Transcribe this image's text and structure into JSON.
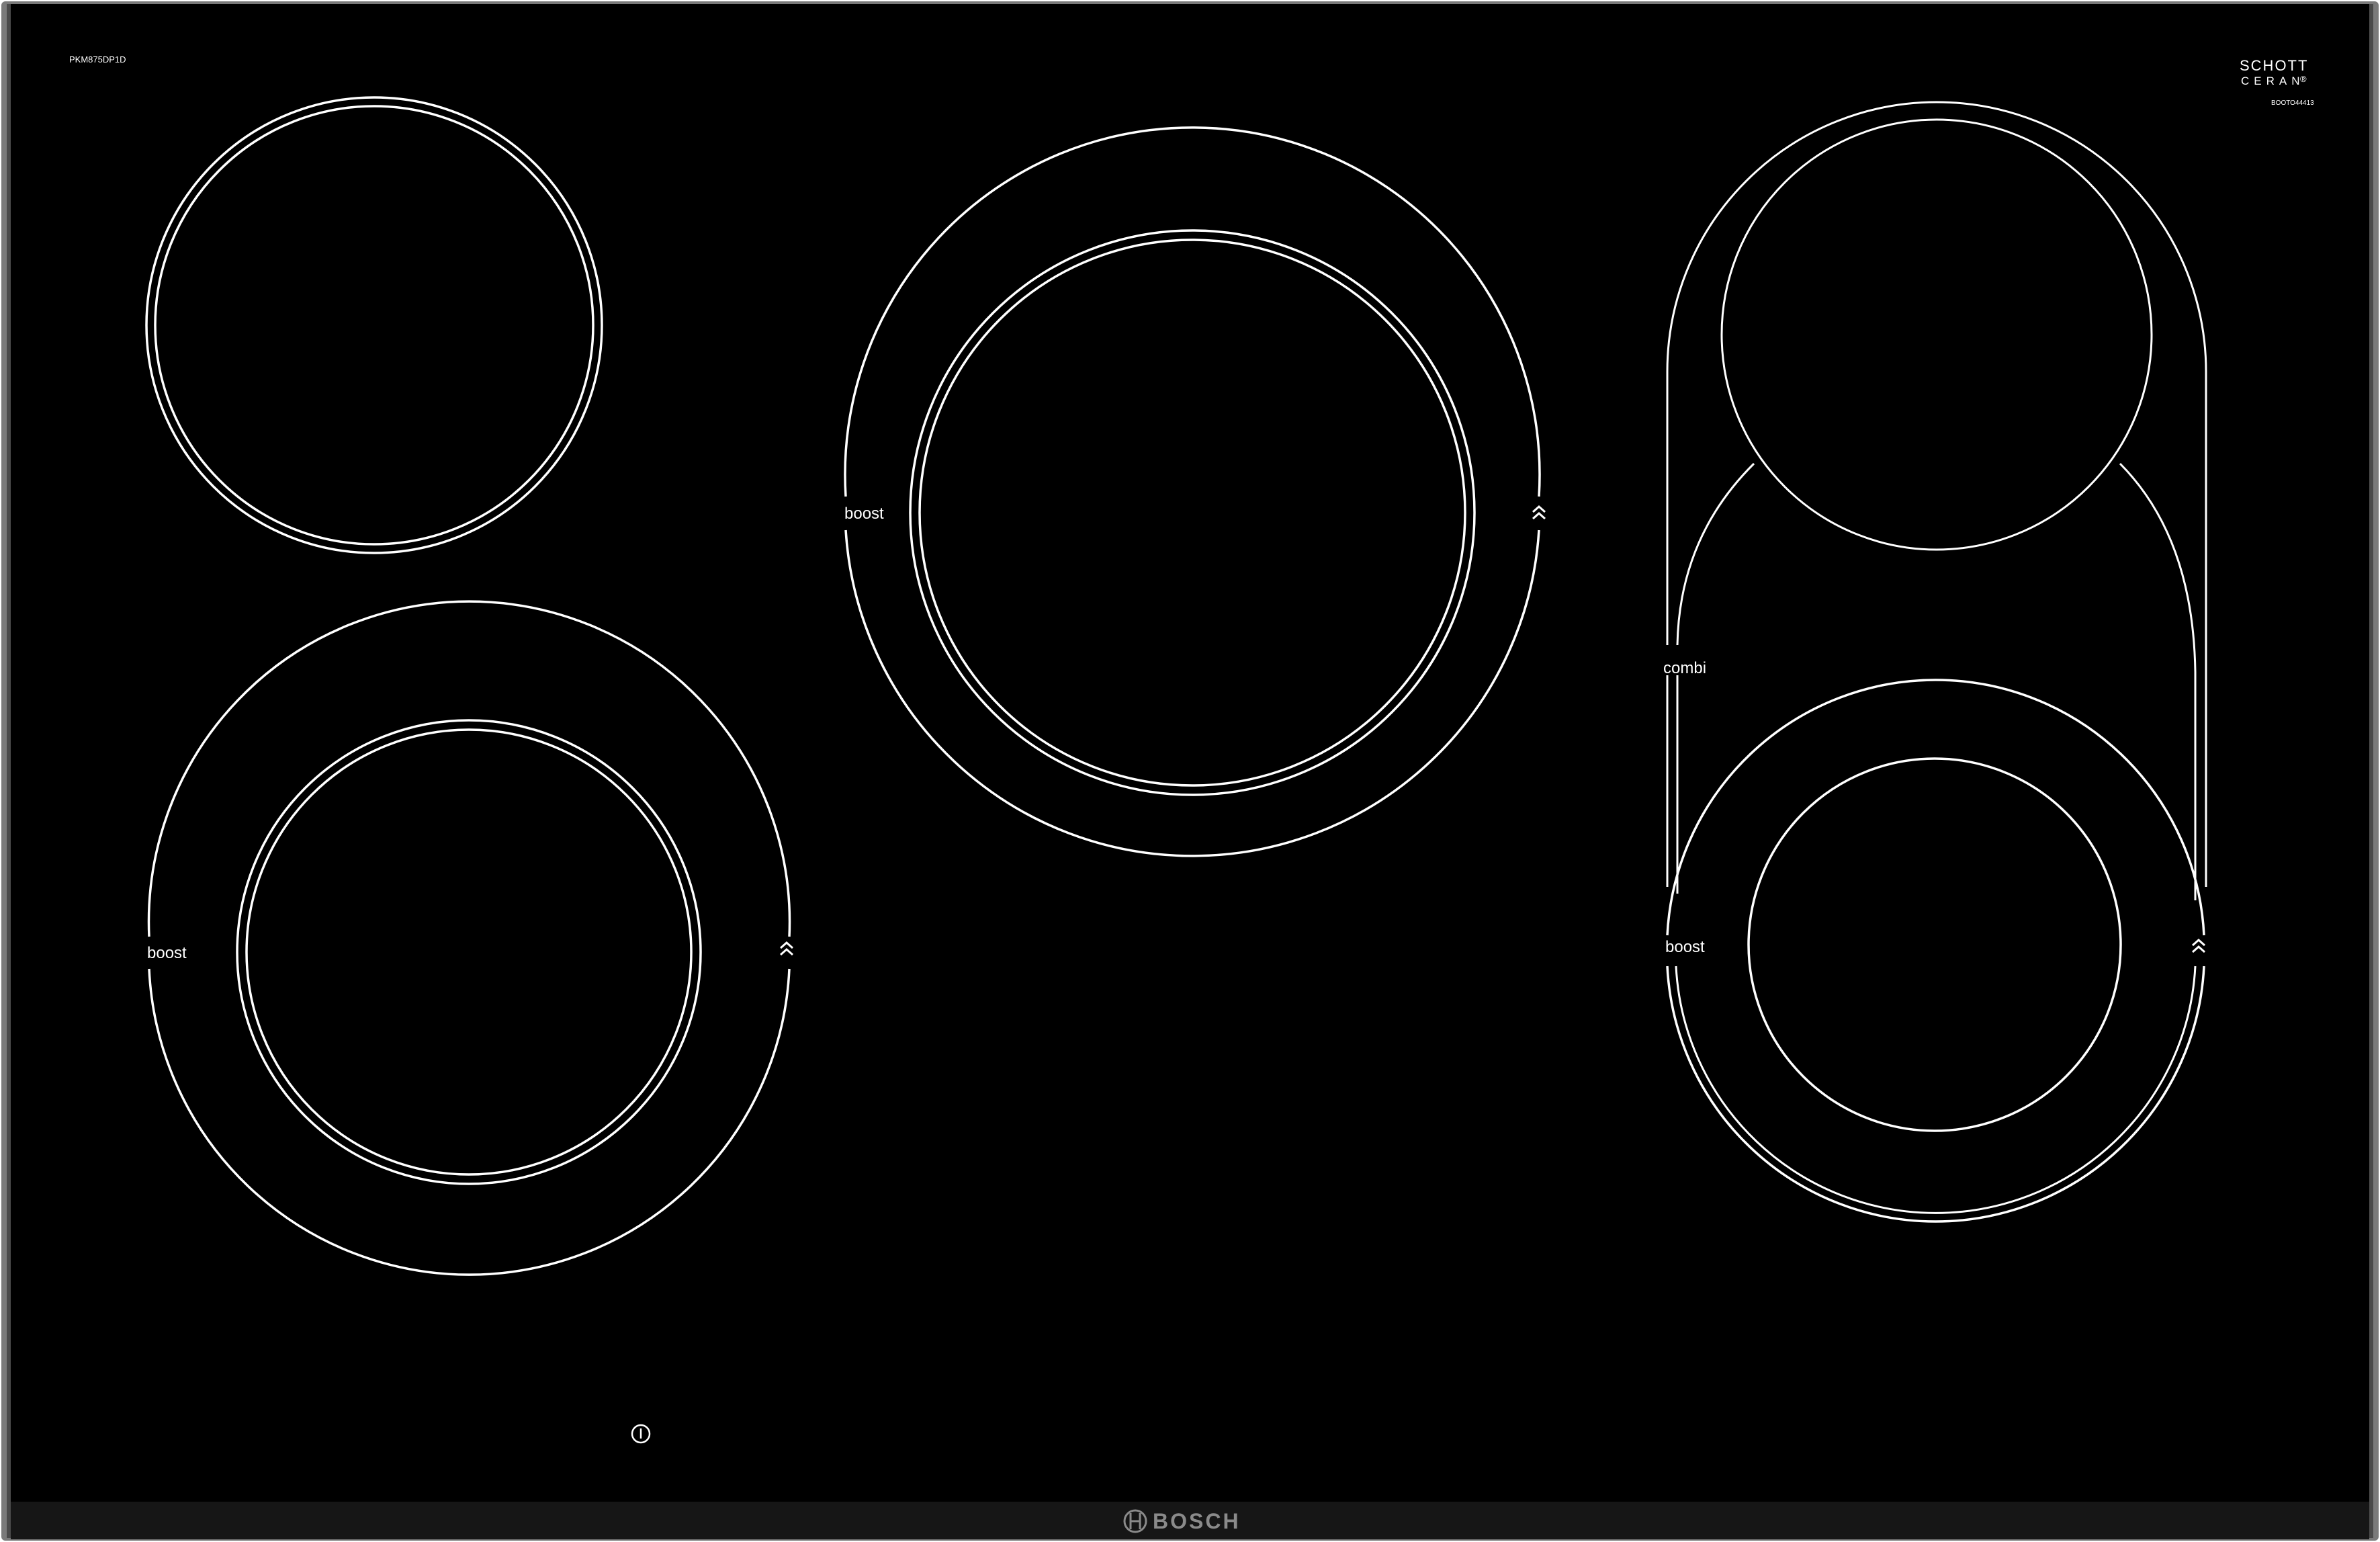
{
  "model_code": "PKM875DP1D",
  "certification": {
    "line1": "SCHOTT",
    "line2": "CERAN",
    "mark": "®",
    "code": "BOOTO44413"
  },
  "labels": {
    "boost_left": "boost",
    "boost_center": "boost",
    "boost_right": "boost",
    "combi": "combi"
  },
  "brand": "BOSCH",
  "icons": {
    "power": "power-icon",
    "boost_arrow": "double-chevron-up-icon",
    "brand_logo": "bosch-armature-icon"
  },
  "colors": {
    "glass": "#000000",
    "trim": "#1a1a1a",
    "lines": "#ffffff",
    "brand_text": "#8a8a8a",
    "frame": "#6e6e6e"
  }
}
